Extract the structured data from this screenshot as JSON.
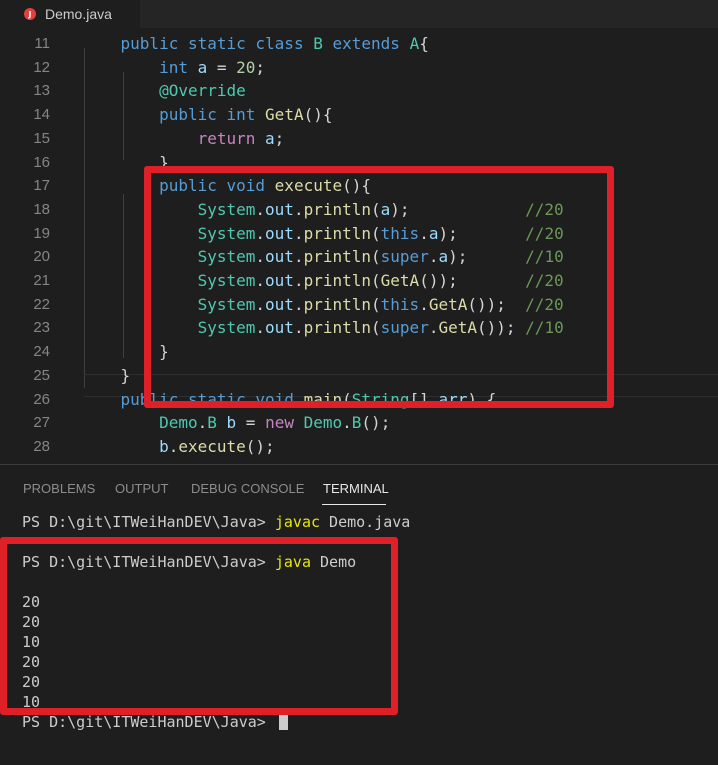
{
  "tab": {
    "icon_letter": "J",
    "filename": "Demo.java"
  },
  "editor": {
    "lines": [
      {
        "num": "11",
        "tokens": [
          [
            "    ",
            ""
          ],
          [
            "public",
            "kw"
          ],
          [
            " ",
            ""
          ],
          [
            "static",
            "kw"
          ],
          [
            " ",
            ""
          ],
          [
            "class",
            "kw"
          ],
          [
            " ",
            ""
          ],
          [
            "B",
            "ty"
          ],
          [
            " ",
            ""
          ],
          [
            "extends",
            "kw"
          ],
          [
            " ",
            ""
          ],
          [
            "A",
            "ty"
          ],
          [
            "{",
            ""
          ]
        ]
      },
      {
        "num": "12",
        "tokens": [
          [
            "        ",
            ""
          ],
          [
            "int",
            "kw"
          ],
          [
            " ",
            ""
          ],
          [
            "a",
            "va"
          ],
          [
            " = ",
            ""
          ],
          [
            "20",
            "num"
          ],
          [
            ";",
            ""
          ]
        ]
      },
      {
        "num": "13",
        "tokens": [
          [
            "        ",
            ""
          ],
          [
            "@Override",
            "ty"
          ]
        ]
      },
      {
        "num": "14",
        "tokens": [
          [
            "        ",
            ""
          ],
          [
            "public",
            "kw"
          ],
          [
            " ",
            ""
          ],
          [
            "int",
            "kw"
          ],
          [
            " ",
            ""
          ],
          [
            "GetA",
            "fn"
          ],
          [
            "(){",
            ""
          ]
        ]
      },
      {
        "num": "15",
        "tokens": [
          [
            "            ",
            ""
          ],
          [
            "return",
            "ctl"
          ],
          [
            " ",
            ""
          ],
          [
            "a",
            "va"
          ],
          [
            ";",
            ""
          ]
        ]
      },
      {
        "num": "16",
        "tokens": [
          [
            "        }",
            ""
          ]
        ]
      },
      {
        "num": "17",
        "tokens": [
          [
            "        ",
            ""
          ],
          [
            "public",
            "kw"
          ],
          [
            " ",
            ""
          ],
          [
            "void",
            "kw"
          ],
          [
            " ",
            ""
          ],
          [
            "execute",
            "fn"
          ],
          [
            "(){",
            ""
          ]
        ]
      },
      {
        "num": "18",
        "tokens": [
          [
            "            ",
            ""
          ],
          [
            "System",
            "ty"
          ],
          [
            ".",
            ""
          ],
          [
            "out",
            "va"
          ],
          [
            ".",
            ""
          ],
          [
            "println",
            "fn"
          ],
          [
            "(",
            ""
          ],
          [
            "a",
            "va"
          ],
          [
            ");            ",
            ""
          ],
          [
            "//20",
            "cm"
          ]
        ]
      },
      {
        "num": "19",
        "tokens": [
          [
            "            ",
            ""
          ],
          [
            "System",
            "ty"
          ],
          [
            ".",
            ""
          ],
          [
            "out",
            "va"
          ],
          [
            ".",
            ""
          ],
          [
            "println",
            "fn"
          ],
          [
            "(",
            ""
          ],
          [
            "this",
            "kw"
          ],
          [
            ".",
            ""
          ],
          [
            "a",
            "va"
          ],
          [
            ");       ",
            ""
          ],
          [
            "//20",
            "cm"
          ]
        ]
      },
      {
        "num": "20",
        "tokens": [
          [
            "            ",
            ""
          ],
          [
            "System",
            "ty"
          ],
          [
            ".",
            ""
          ],
          [
            "out",
            "va"
          ],
          [
            ".",
            ""
          ],
          [
            "println",
            "fn"
          ],
          [
            "(",
            ""
          ],
          [
            "super",
            "kw"
          ],
          [
            ".",
            ""
          ],
          [
            "a",
            "va"
          ],
          [
            ");      ",
            ""
          ],
          [
            "//10",
            "cm"
          ]
        ]
      },
      {
        "num": "21",
        "tokens": [
          [
            "            ",
            ""
          ],
          [
            "System",
            "ty"
          ],
          [
            ".",
            ""
          ],
          [
            "out",
            "va"
          ],
          [
            ".",
            ""
          ],
          [
            "println",
            "fn"
          ],
          [
            "(",
            ""
          ],
          [
            "GetA",
            "fn"
          ],
          [
            "());       ",
            ""
          ],
          [
            "//20",
            "cm"
          ]
        ]
      },
      {
        "num": "22",
        "tokens": [
          [
            "            ",
            ""
          ],
          [
            "System",
            "ty"
          ],
          [
            ".",
            ""
          ],
          [
            "out",
            "va"
          ],
          [
            ".",
            ""
          ],
          [
            "println",
            "fn"
          ],
          [
            "(",
            ""
          ],
          [
            "this",
            "kw"
          ],
          [
            ".",
            ""
          ],
          [
            "GetA",
            "fn"
          ],
          [
            "());  ",
            ""
          ],
          [
            "//20",
            "cm"
          ]
        ]
      },
      {
        "num": "23",
        "tokens": [
          [
            "            ",
            ""
          ],
          [
            "System",
            "ty"
          ],
          [
            ".",
            ""
          ],
          [
            "out",
            "va"
          ],
          [
            ".",
            ""
          ],
          [
            "println",
            "fn"
          ],
          [
            "(",
            ""
          ],
          [
            "super",
            "kw"
          ],
          [
            ".",
            ""
          ],
          [
            "GetA",
            "fn"
          ],
          [
            "()); ",
            ""
          ],
          [
            "//10",
            "cm"
          ]
        ]
      },
      {
        "num": "24",
        "tokens": [
          [
            "        }",
            ""
          ]
        ]
      },
      {
        "num": "25",
        "tokens": [
          [
            "    }",
            ""
          ]
        ]
      },
      {
        "num": "26",
        "tokens": [
          [
            "    ",
            ""
          ],
          [
            "public",
            "kw"
          ],
          [
            " ",
            ""
          ],
          [
            "static",
            "kw"
          ],
          [
            " ",
            ""
          ],
          [
            "void",
            "kw"
          ],
          [
            " ",
            ""
          ],
          [
            "main",
            "fn"
          ],
          [
            "(",
            ""
          ],
          [
            "String",
            "ty"
          ],
          [
            "[] ",
            ""
          ],
          [
            "arr",
            "va"
          ],
          [
            ") {",
            ""
          ]
        ]
      },
      {
        "num": "27",
        "tokens": [
          [
            "        ",
            ""
          ],
          [
            "Demo",
            "ty"
          ],
          [
            ".",
            ""
          ],
          [
            "B",
            "ty"
          ],
          [
            " ",
            ""
          ],
          [
            "b",
            "va"
          ],
          [
            " = ",
            ""
          ],
          [
            "new",
            "ctl"
          ],
          [
            " ",
            ""
          ],
          [
            "Demo",
            "ty"
          ],
          [
            ".",
            ""
          ],
          [
            "B",
            "ty"
          ],
          [
            "();",
            ""
          ]
        ]
      },
      {
        "num": "28",
        "tokens": [
          [
            "        ",
            ""
          ],
          [
            "b",
            "va"
          ],
          [
            ".",
            ""
          ],
          [
            "execute",
            "fn"
          ],
          [
            "();",
            ""
          ]
        ]
      }
    ]
  },
  "panel": {
    "tabs": [
      "PROBLEMS",
      "OUTPUT",
      "DEBUG CONSOLE",
      "TERMINAL"
    ],
    "active_tab": "TERMINAL"
  },
  "terminal": {
    "prompt": "PS D:\\git\\ITWeiHanDEV\\Java> ",
    "cmd1": "javac",
    "cmd1_arg": " Demo.java",
    "cmd2": "java",
    "cmd2_arg": " Demo",
    "outputs": [
      "20",
      "20",
      "10",
      "20",
      "20",
      "10"
    ]
  },
  "colors": {
    "highlight_box": "#e02028",
    "keyword": "#569cd6",
    "type": "#4ec9b0",
    "function": "#dcdcaa",
    "comment": "#6a9955"
  }
}
